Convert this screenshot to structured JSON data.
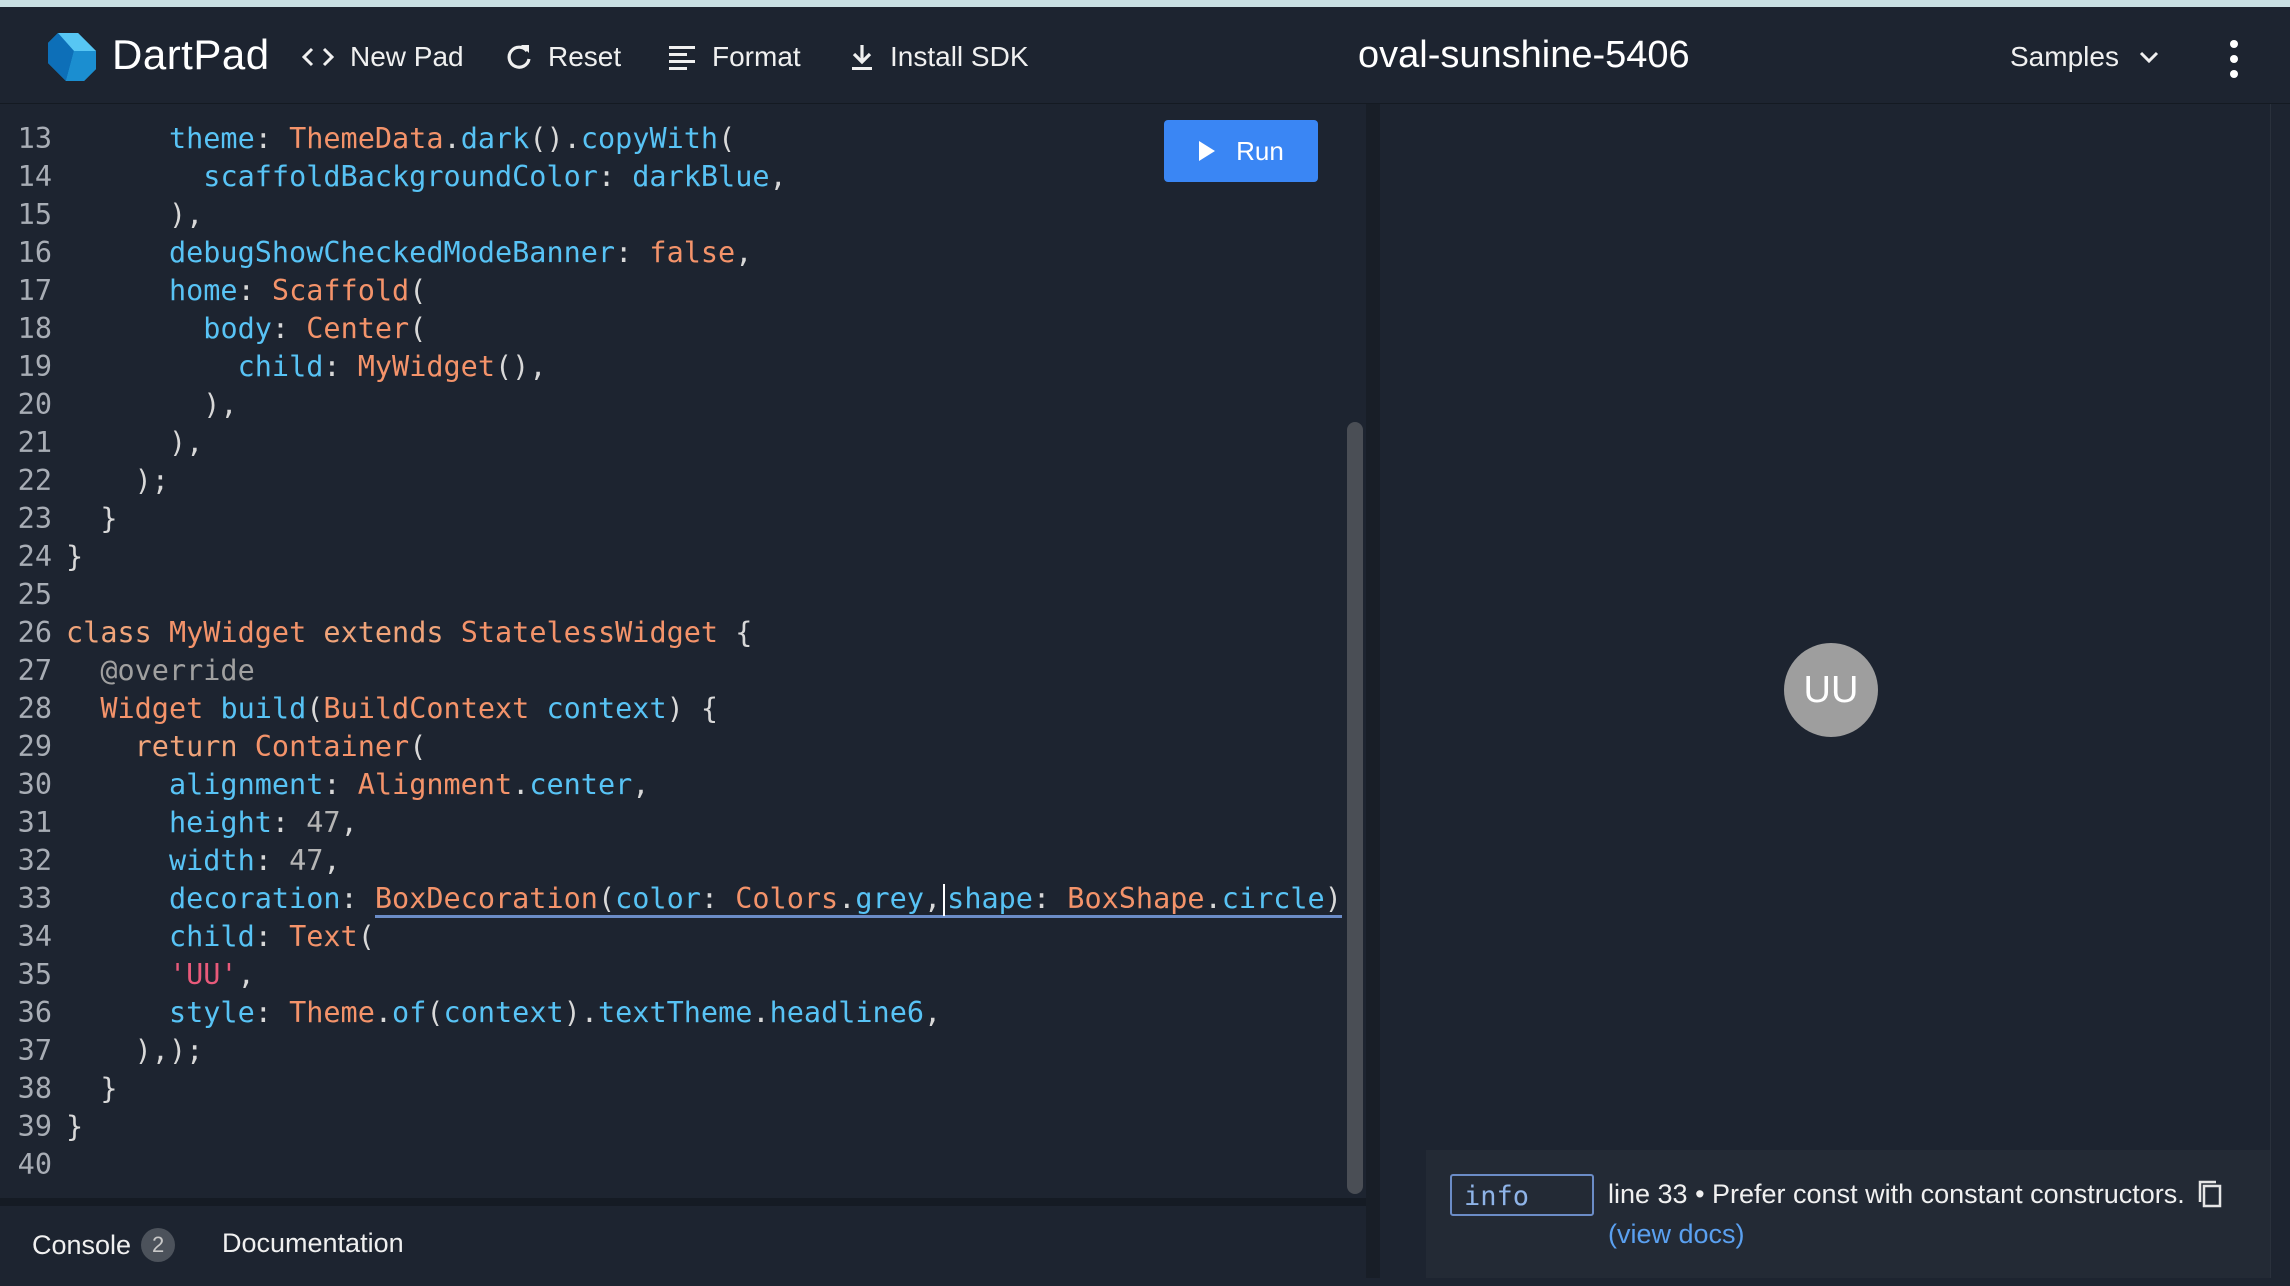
{
  "header": {
    "brand": "DartPad",
    "new_pad": "New Pad",
    "reset": "Reset",
    "format": "Format",
    "install_sdk": "Install SDK",
    "pad_name": "oval-sunshine-5406",
    "samples": "Samples"
  },
  "editor": {
    "run_label": "Run",
    "lines": [
      {
        "n": "13"
      },
      {
        "n": "14"
      },
      {
        "n": "15"
      },
      {
        "n": "16"
      },
      {
        "n": "17"
      },
      {
        "n": "18"
      },
      {
        "n": "19"
      },
      {
        "n": "20"
      },
      {
        "n": "21"
      },
      {
        "n": "22"
      },
      {
        "n": "23"
      },
      {
        "n": "24"
      },
      {
        "n": "25"
      },
      {
        "n": "26"
      },
      {
        "n": "27"
      },
      {
        "n": "28"
      },
      {
        "n": "29"
      },
      {
        "n": "30"
      },
      {
        "n": "31"
      },
      {
        "n": "32"
      },
      {
        "n": "33"
      },
      {
        "n": "34"
      },
      {
        "n": "35"
      },
      {
        "n": "36"
      },
      {
        "n": "37"
      },
      {
        "n": "38"
      },
      {
        "n": "39"
      },
      {
        "n": "40"
      }
    ],
    "tokens": {
      "theme": "theme",
      "themedata": "ThemeData",
      "dark": "dark",
      "copywith": "copyWith",
      "scaffoldbg": "scaffoldBackgroundColor",
      "darkblue": "darkBlue",
      "debugbanner": "debugShowCheckedModeBanner",
      "false": "false",
      "home": "home",
      "scaffold": "Scaffold",
      "body": "body",
      "center": "Center",
      "child": "child",
      "mywidget": "MyWidget",
      "class": "class",
      "extends": "extends",
      "statelesswidget": "StatelessWidget",
      "override": "@override",
      "widget": "Widget",
      "build": "build",
      "buildcontext": "BuildContext",
      "context": "context",
      "return": "return",
      "container": "Container",
      "alignment": "alignment",
      "alignment_cls": "Alignment",
      "center_prop": "center",
      "height": "height",
      "h_val": "47",
      "width": "width",
      "w_val": "47",
      "decoration": "decoration",
      "boxdecoration": "BoxDecoration",
      "color": "color",
      "colors": "Colors",
      "grey": "grey",
      "shape": "shape",
      "boxshape": "BoxShape",
      "circle": "circle",
      "text": "Text",
      "uu_str": "'UU'",
      "style": "style",
      "theme_cls": "Theme",
      "of": "of",
      "texttheme": "textTheme",
      "headline6": "headline6"
    }
  },
  "bottom_tabs": {
    "console": "Console",
    "console_count": "2",
    "documentation": "Documentation"
  },
  "output": {
    "avatar_text": "UU"
  },
  "issue": {
    "level": "info",
    "message": "line 33 • Prefer const with constant constructors.",
    "link": "(view docs)"
  },
  "colors": {
    "background": "#1d2430",
    "run_button": "#3a86f4",
    "avatar": "#9e9e9e",
    "link": "#5aa0f0"
  }
}
